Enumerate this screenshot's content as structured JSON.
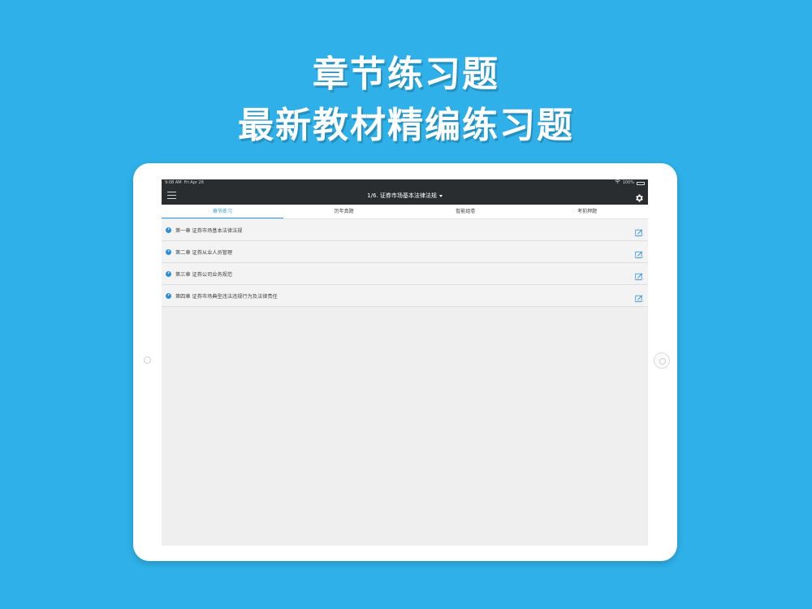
{
  "promo": {
    "line1": "章节练习题",
    "line2": "最新教材精编练习题"
  },
  "status_bar": {
    "time": "9:08 AM",
    "date": "Fri Apr 26",
    "battery": "100%"
  },
  "nav": {
    "title": "1/6. 证券市场基本法律法规"
  },
  "tabs": [
    {
      "label": "章节练习",
      "active": true
    },
    {
      "label": "历年真题",
      "active": false
    },
    {
      "label": "智能组卷",
      "active": false
    },
    {
      "label": "考前押题",
      "active": false
    }
  ],
  "chapters": [
    {
      "label": "第一章 证券市场基本法律法规"
    },
    {
      "label": "第二章 证券从业人员管理"
    },
    {
      "label": "第三章 证券公司业务规范"
    },
    {
      "label": "第四章 证券市场典型违法违规行为及法律责任"
    }
  ],
  "colors": {
    "background": "#2fb0e8",
    "navbar": "#2a2d30",
    "accent": "#2e9be0"
  }
}
